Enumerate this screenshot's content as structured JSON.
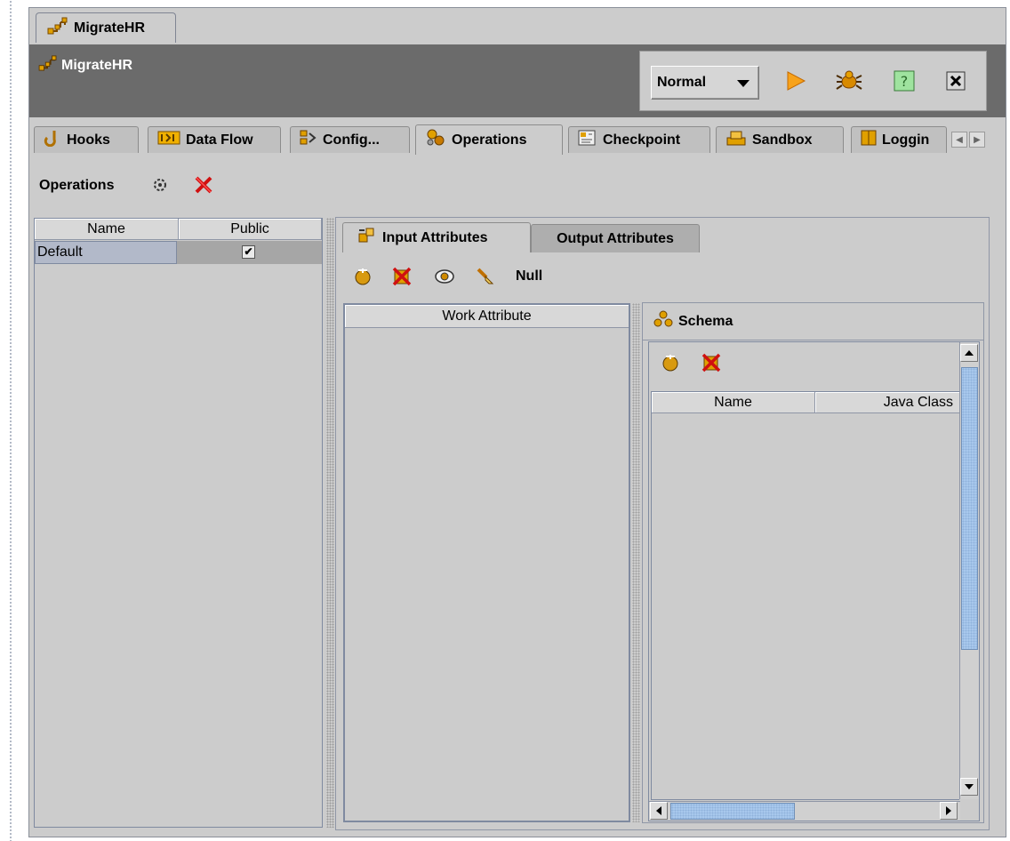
{
  "document_tab": {
    "label": "MigrateHR",
    "icon": "key-node-icon"
  },
  "header": {
    "title": "MigrateHR",
    "mode_select": "Normal",
    "buttons": [
      "run-icon",
      "debug-bug-icon",
      "help-icon",
      "close-icon"
    ]
  },
  "main_tabs": [
    {
      "label": "Hooks",
      "icon": "hook-icon"
    },
    {
      "label": "Data Flow",
      "icon": "data-flow-icon"
    },
    {
      "label": "Config...",
      "icon": "config-icon"
    },
    {
      "label": "Operations",
      "icon": "operations-icon",
      "active": true
    },
    {
      "label": "Checkpoint",
      "icon": "checkpoint-icon"
    },
    {
      "label": "Sandbox",
      "icon": "sandbox-icon"
    },
    {
      "label": "Loggin",
      "icon": "logging-icon"
    }
  ],
  "operations": {
    "label": "Operations",
    "table": {
      "columns": [
        "Name",
        "Public"
      ],
      "rows": [
        {
          "name": "Default",
          "public": true
        }
      ]
    }
  },
  "attributes": {
    "tabs": [
      "Input Attributes",
      "Output Attributes"
    ],
    "active_tab": "Input Attributes",
    "null_label": "Null",
    "work_table": {
      "columns": [
        "Work Attribute"
      ]
    },
    "schema": {
      "title": "Schema",
      "columns": [
        "Name",
        "Java Class"
      ]
    }
  },
  "colors": {
    "header_bg": "#6b6b6b",
    "panel_bg": "#cccccc",
    "selection": "#b2b9c9",
    "scroll_thumb": "#a8c8ec"
  }
}
